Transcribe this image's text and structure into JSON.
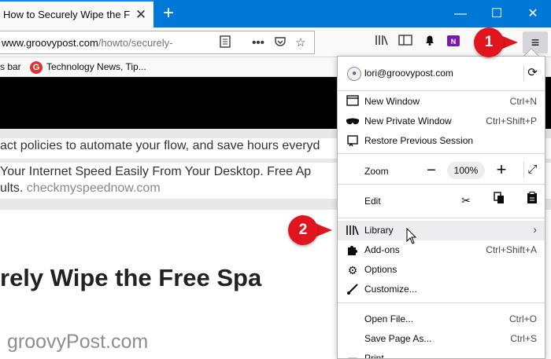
{
  "tab": {
    "title": "How to Securely Wipe the Free",
    "close": "✕"
  },
  "window": {
    "minimize": "—",
    "maximize": "☐",
    "close": "✕",
    "new_tab": "+"
  },
  "url": {
    "prefix": "www.groovypost.com",
    "path": "/howto/securely-"
  },
  "bookmarks": {
    "item1": "s bar",
    "item2": "Technology News, Tip...",
    "item2_favicon": "G"
  },
  "page": {
    "line1": "act policies to automate your flow, and save hours everyd",
    "line2": "Your Internet Speed Easily From Your Desktop. Free Ap",
    "line3_prefix": "ults.",
    "line3_link": " checkmyspeednow.com",
    "headline": "rely Wipe the Free Spa",
    "watermark": "groovyPost.com"
  },
  "menu": {
    "account": "lori@groovypost.com",
    "new_window": {
      "label": "New Window",
      "shortcut": "Ctrl+N"
    },
    "new_private": {
      "label": "New Private Window",
      "shortcut": "Ctrl+Shift+P"
    },
    "restore": {
      "label": "Restore Previous Session"
    },
    "zoom": {
      "label": "Zoom",
      "minus": "−",
      "value": "100%",
      "plus": "+"
    },
    "edit": {
      "label": "Edit"
    },
    "library": {
      "label": "Library",
      "chevron": "›"
    },
    "addons": {
      "label": "Add-ons",
      "shortcut": "Ctrl+Shift+A"
    },
    "options": {
      "label": "Options"
    },
    "customize": {
      "label": "Customize..."
    },
    "open_file": {
      "label": "Open File...",
      "shortcut": "Ctrl+O"
    },
    "save_page": {
      "label": "Save Page As...",
      "shortcut": "Ctrl+S"
    },
    "print": {
      "label": "Print..."
    }
  },
  "callouts": {
    "one": "1",
    "two": "2"
  },
  "colors": {
    "titlebar": "#0078d7",
    "callout": "#e0151d",
    "accent": "#0a84ff"
  }
}
